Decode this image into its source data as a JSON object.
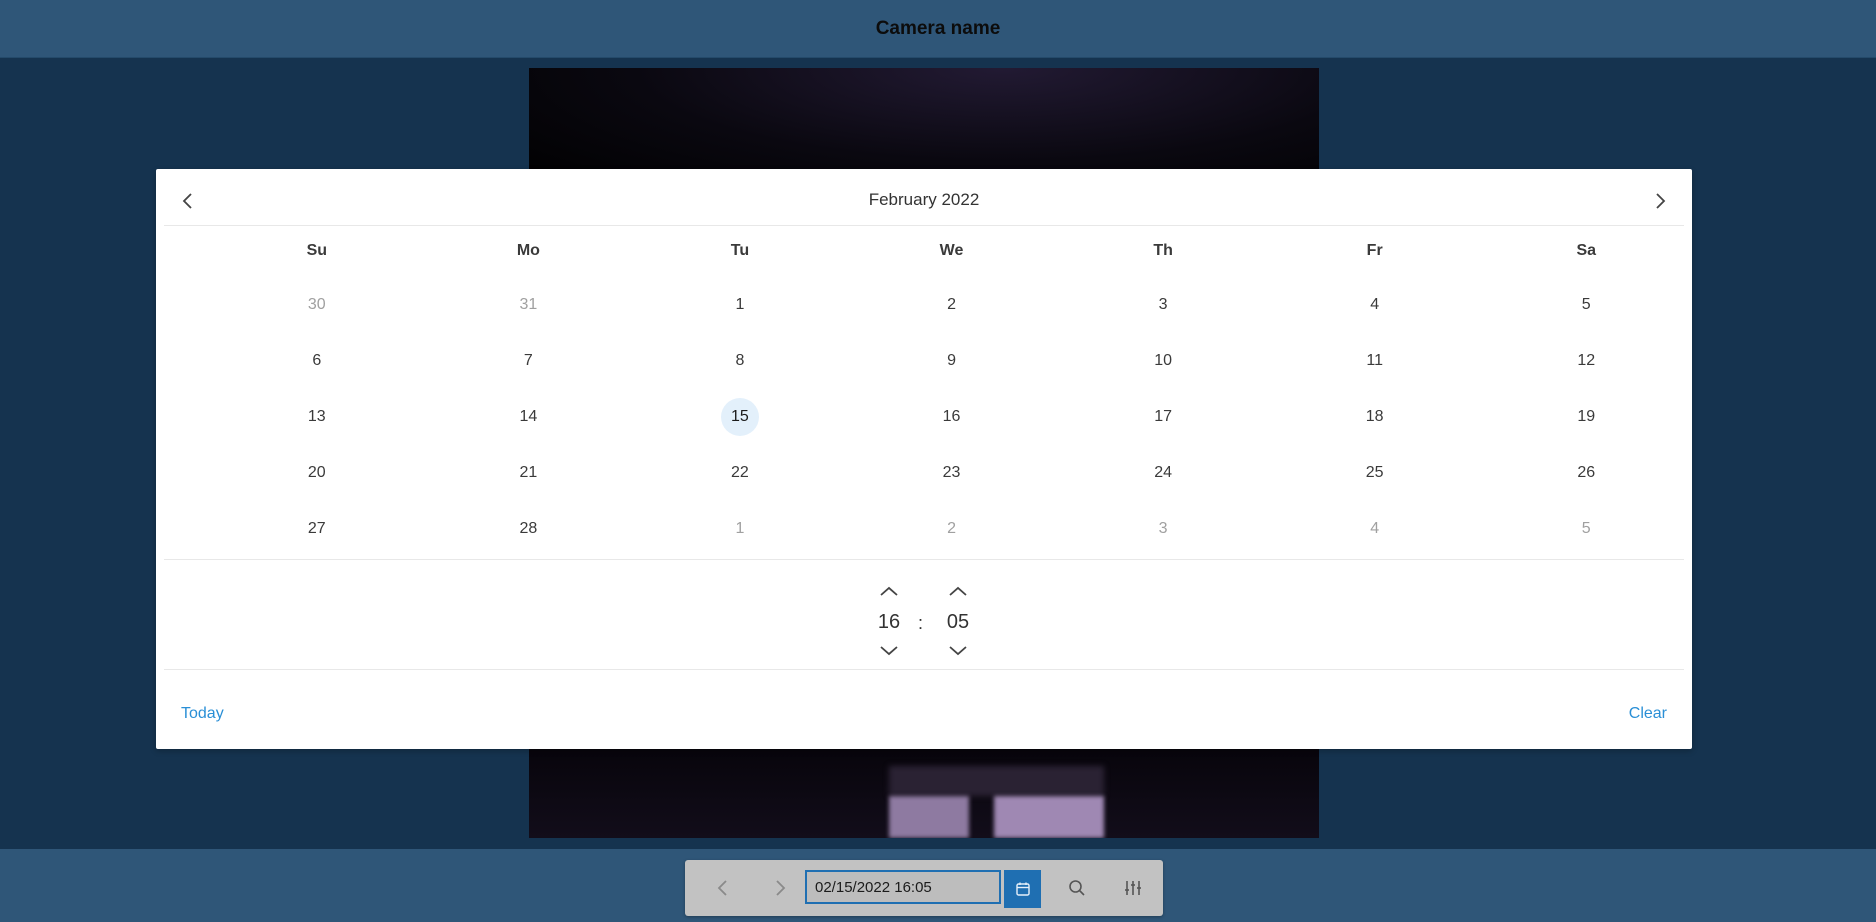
{
  "header": {
    "title": "Camera name"
  },
  "picker": {
    "month_label": "February  2022",
    "weekdays": [
      "Su",
      "Mo",
      "Tu",
      "We",
      "Th",
      "Fr",
      "Sa"
    ],
    "weeks": [
      [
        {
          "d": "30",
          "muted": true
        },
        {
          "d": "31",
          "muted": true
        },
        {
          "d": "1"
        },
        {
          "d": "2"
        },
        {
          "d": "3"
        },
        {
          "d": "4"
        },
        {
          "d": "5"
        }
      ],
      [
        {
          "d": "6"
        },
        {
          "d": "7"
        },
        {
          "d": "8"
        },
        {
          "d": "9"
        },
        {
          "d": "10"
        },
        {
          "d": "11"
        },
        {
          "d": "12"
        }
      ],
      [
        {
          "d": "13"
        },
        {
          "d": "14"
        },
        {
          "d": "15",
          "selected": true
        },
        {
          "d": "16"
        },
        {
          "d": "17"
        },
        {
          "d": "18"
        },
        {
          "d": "19"
        }
      ],
      [
        {
          "d": "20"
        },
        {
          "d": "21"
        },
        {
          "d": "22"
        },
        {
          "d": "23"
        },
        {
          "d": "24"
        },
        {
          "d": "25"
        },
        {
          "d": "26"
        }
      ],
      [
        {
          "d": "27"
        },
        {
          "d": "28"
        },
        {
          "d": "1",
          "muted": true
        },
        {
          "d": "2",
          "muted": true
        },
        {
          "d": "3",
          "muted": true
        },
        {
          "d": "4",
          "muted": true
        },
        {
          "d": "5",
          "muted": true
        }
      ]
    ],
    "time": {
      "hour": "16",
      "separator": ":",
      "minute": "05"
    },
    "footer": {
      "today_label": "Today",
      "clear_label": "Clear"
    }
  },
  "toolbar": {
    "datetime_value": "02/15/2022 16:05",
    "icons": [
      "chevron-left-icon",
      "chevron-right-icon",
      "calendar-icon",
      "search-icon",
      "sliders-icon"
    ]
  },
  "colors": {
    "background": "#15334f",
    "bar": "#2f5678",
    "accent": "#1f6fb2",
    "link": "#2a8fd6",
    "selected_day": "#e3f0fb"
  }
}
